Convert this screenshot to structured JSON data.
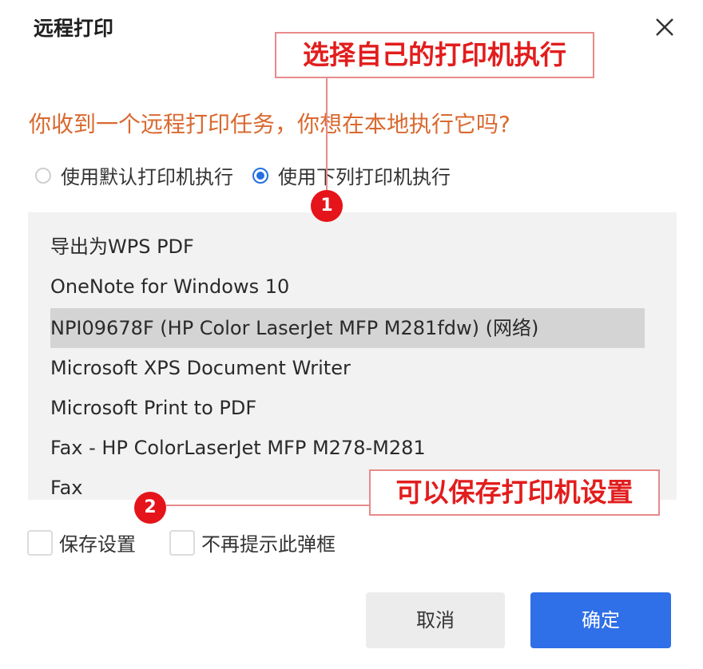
{
  "dialog": {
    "title": "远程打印",
    "question": "你收到一个远程打印任务，你想在本地执行它吗?"
  },
  "radio_options": [
    {
      "label": "使用默认打印机执行",
      "checked": false
    },
    {
      "label": "使用下列打印机执行",
      "checked": true
    }
  ],
  "printers": [
    {
      "name": "导出为WPS PDF",
      "selected": false
    },
    {
      "name": "OneNote for Windows 10",
      "selected": false
    },
    {
      "name": "NPI09678F (HP Color LaserJet MFP M281fdw) (网络)",
      "selected": true
    },
    {
      "name": "Microsoft XPS Document Writer",
      "selected": false
    },
    {
      "name": "Microsoft Print to PDF",
      "selected": false
    },
    {
      "name": "Fax - HP ColorLaserJet MFP M278-M281",
      "selected": false
    },
    {
      "name": "Fax",
      "selected": false
    }
  ],
  "checkboxes": [
    {
      "label": "保存设置",
      "checked": false
    },
    {
      "label": "不再提示此弹框",
      "checked": false
    }
  ],
  "buttons": {
    "cancel": "取消",
    "ok": "确定"
  },
  "annotations": {
    "callout_1": "选择自己的打印机执行",
    "callout_2": "可以保存打印机设置",
    "marker_1": "1",
    "marker_2": "2"
  },
  "icons": {
    "close": "close-icon"
  },
  "colors": {
    "accent": "#2f6fe8",
    "question": "#d9692f",
    "annotation_red": "#e21d1d",
    "marker_red": "#e5141a"
  }
}
